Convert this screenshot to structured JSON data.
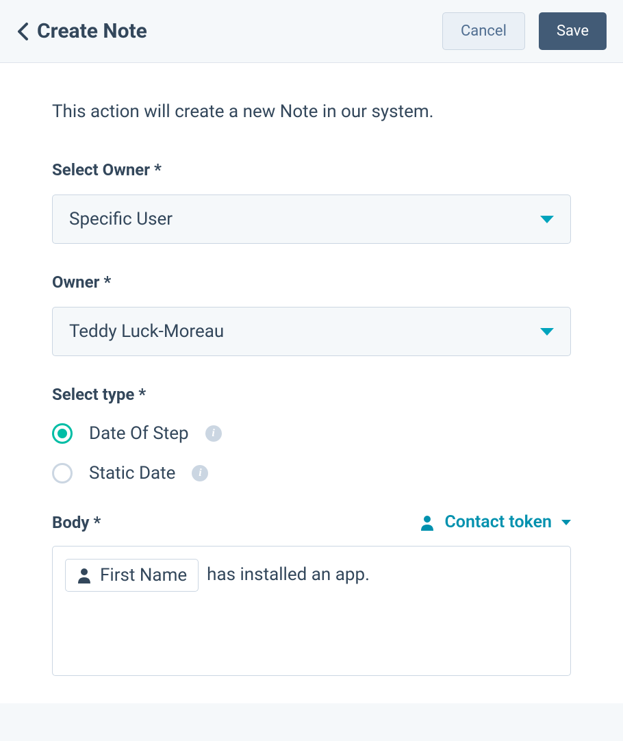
{
  "header": {
    "title": "Create Note",
    "cancel": "Cancel",
    "save": "Save"
  },
  "description": "This action will create a new Note in our system.",
  "form": {
    "selectOwner": {
      "label": "Select Owner *",
      "value": "Specific User"
    },
    "owner": {
      "label": "Owner *",
      "value": "Teddy Luck-Moreau"
    },
    "selectType": {
      "label": "Select type *",
      "options": {
        "dateOfStep": "Date Of Step",
        "staticDate": "Static Date"
      }
    },
    "body": {
      "label": "Body *",
      "contactToken": "Contact token",
      "tokenChip": "First Name",
      "text": "has installed an app."
    }
  }
}
